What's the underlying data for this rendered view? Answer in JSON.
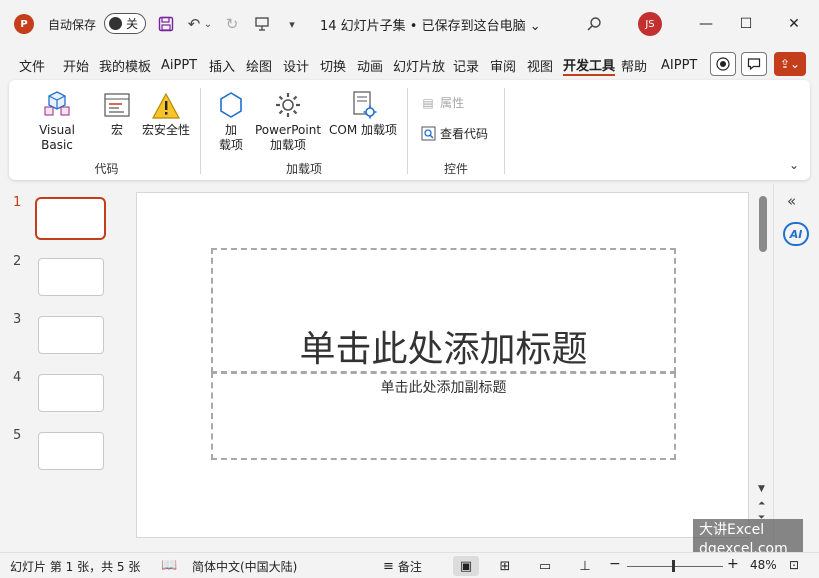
{
  "titlebar": {
    "app_logo": "P",
    "autosave_label": "自动保存",
    "autosave_state": "关",
    "doc_title": "14 幻灯片子集 • 已保存到这台电脑 ⌄",
    "user_initials": "JS",
    "icons": [
      "save-icon",
      "undo-icon",
      "redo-icon",
      "present-from-start-icon",
      "customize-quick-access-icon",
      "search-icon",
      "minimize-icon",
      "maximize-icon",
      "close-icon"
    ]
  },
  "menu": {
    "tabs": [
      "文件",
      "开始",
      "我的模板",
      "AiPPT",
      "插入",
      "绘图",
      "设计",
      "切换",
      "动画",
      "幻灯片放",
      "记录",
      "审阅",
      "视图",
      "开发工具",
      "帮助",
      "AIPPT"
    ],
    "active_tab": "开发工具"
  },
  "ribbon": {
    "code": {
      "label": "代码",
      "visual_basic": "Visual Basic",
      "macros": "宏",
      "macro_security": "宏安全性"
    },
    "addins": {
      "label": "加载项",
      "addins_line1": "加",
      "addins_line2": "载项",
      "ppt_addins_line1": "PowerPoint",
      "ppt_addins_line2": "加载项",
      "com_addins": "COM 加载项"
    },
    "controls": {
      "label": "控件",
      "properties": "属性",
      "view_code": "查看代码"
    }
  },
  "slides": {
    "numbers": [
      "1",
      "2",
      "3",
      "4",
      "5"
    ],
    "active_index": 1
  },
  "slide": {
    "title_placeholder": "单击此处添加标题",
    "subtitle_placeholder": "单击此处添加副标题"
  },
  "side_panel": {
    "ai_label": "AI"
  },
  "watermark": {
    "line1": "大讲Excel",
    "line2": "dqexcel.com"
  },
  "status": {
    "slide_info": "幻灯片 第 1 张，共 5 张",
    "language": "简体中文(中国大陆)",
    "notes": "备注",
    "zoom": "48%"
  },
  "colors": {
    "accent": "#c43e1c",
    "avatar": "#c23030",
    "ai_blue": "#1f6fd1"
  }
}
